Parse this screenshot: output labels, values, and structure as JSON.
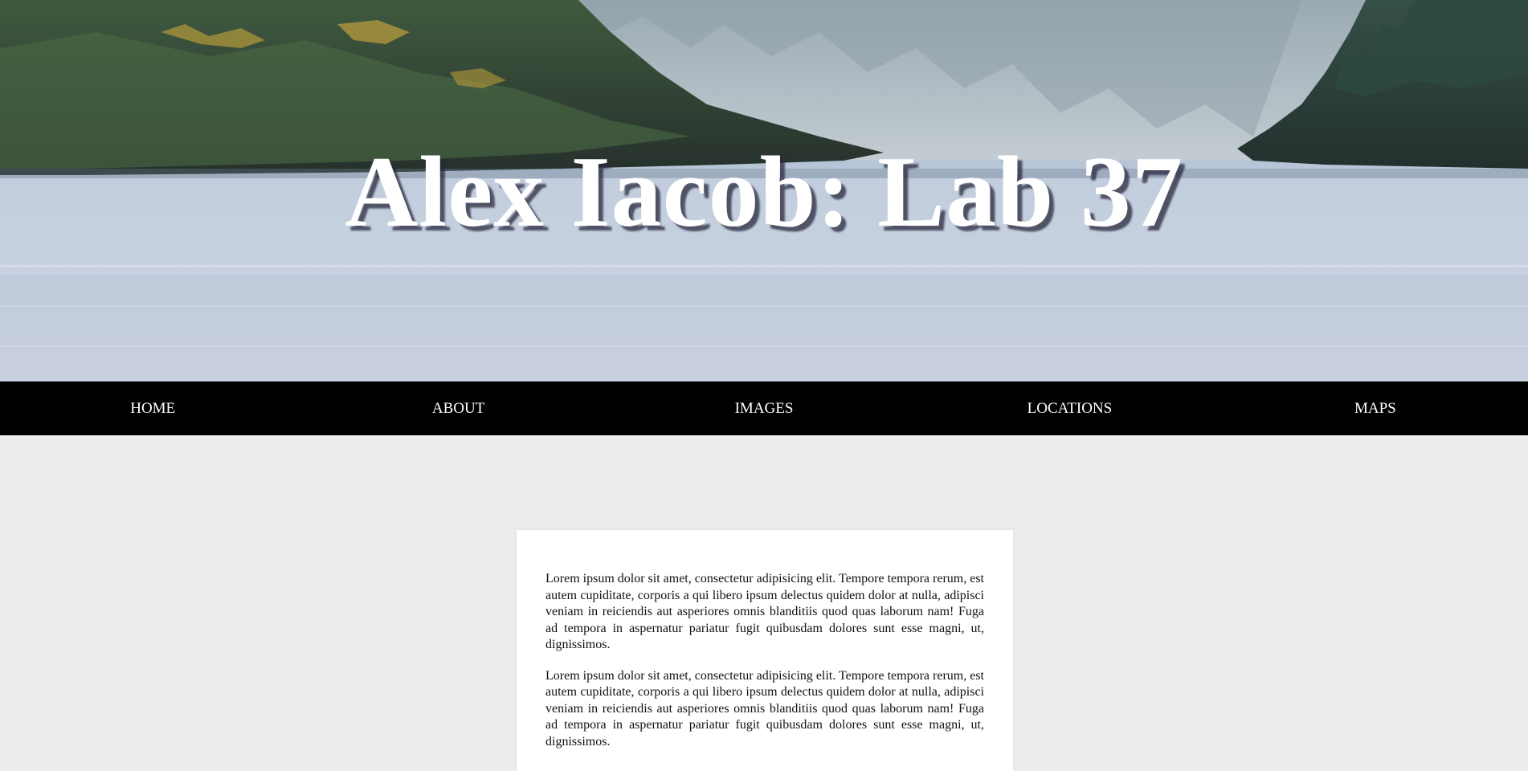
{
  "header": {
    "title": "Alex Iacob: Lab 37"
  },
  "nav": {
    "items": [
      {
        "label": "HOME"
      },
      {
        "label": "ABOUT"
      },
      {
        "label": "IMAGES"
      },
      {
        "label": "LOCATIONS"
      },
      {
        "label": "MAPS"
      }
    ]
  },
  "content": {
    "paragraphs": [
      "Lorem ipsum dolor sit amet, consectetur adipisicing elit. Tempore tempora rerum, est autem cupiditate, corporis a qui libero ipsum delectus quidem dolor at nulla, adipisci veniam in reiciendis aut asperiores omnis blanditiis quod quas laborum nam! Fuga ad tempora in aspernatur pariatur fugit quibusdam dolores sunt esse magni, ut, dignissimos.",
      "Lorem ipsum dolor sit amet, consectetur adipisicing elit. Tempore tempora rerum, est autem cupiditate, corporis a qui libero ipsum delectus quidem dolor at nulla, adipisci veniam in reiciendis aut asperiores omnis blanditiis quod quas laborum nam! Fuga ad tempora in aspernatur pariatur fugit quibusdam dolores sunt esse magni, ut, dignissimos."
    ]
  },
  "colors": {
    "nav_background": "#000000",
    "page_background": "#ededed",
    "card_background": "#ffffff",
    "title_color": "#ffffff"
  }
}
